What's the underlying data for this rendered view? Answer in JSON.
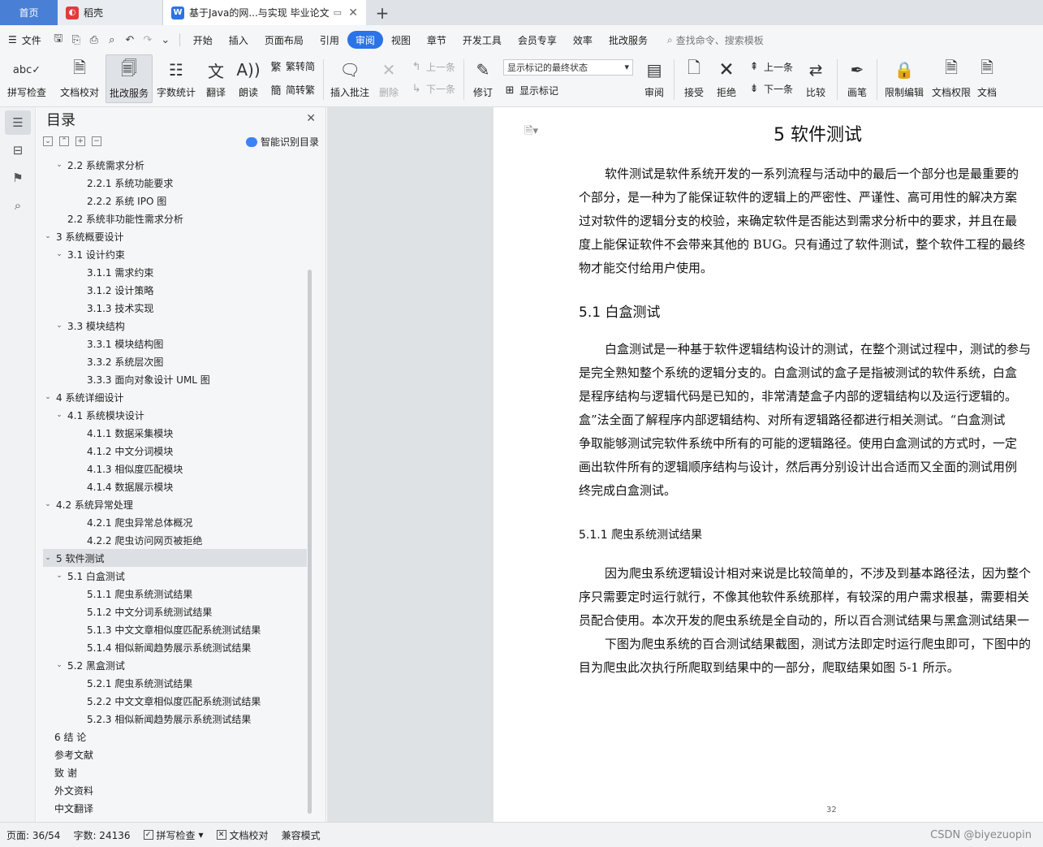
{
  "tabs": {
    "home": "首页",
    "daoke": "稻壳",
    "doc": "基于Java的网...与实现 毕业论文",
    "add": "+"
  },
  "menu": {
    "file": "文件",
    "items": [
      "开始",
      "插入",
      "页面布局",
      "引用",
      "审阅",
      "视图",
      "章节",
      "开发工具",
      "会员专享",
      "效率",
      "批改服务"
    ],
    "active": "审阅",
    "search": "查找命令、搜索模板"
  },
  "ribbon": {
    "spell": "拼写检查",
    "doccheck": "文档校对",
    "correct": "批改服务",
    "wordcount": "字数统计",
    "translate": "翻译",
    "read": "朗读",
    "trad2simp": "繁转简",
    "simp2trad": "简转繁",
    "insert_comment": "插入批注",
    "delete": "删除",
    "prev": "上一条",
    "next": "下一条",
    "revise": "修订",
    "markup_select": "显示标记的最终状态",
    "show_markup": "显示标记",
    "review": "审阅",
    "accept": "接受",
    "reject": "拒绝",
    "prev2": "上一条",
    "next2": "下一条",
    "compare": "比较",
    "pen": "画笔",
    "restrict": "限制编辑",
    "perm": "文档权限",
    "more": "文档"
  },
  "toc": {
    "title": "目录",
    "smart": "智能识别目录",
    "items": [
      {
        "label": "2.2  系统需求分析",
        "level": 2,
        "arrow": true
      },
      {
        "label": "2.2.1  系统功能要求",
        "level": 3,
        "arrow": false
      },
      {
        "label": "2.2.2  系统 IPO 图",
        "level": 3,
        "arrow": false
      },
      {
        "label": "2.2  系统非功能性需求分析",
        "level": 2,
        "arrow": false
      },
      {
        "label": "3    系统概要设计",
        "level": 1,
        "arrow": true
      },
      {
        "label": "3.1  设计约束",
        "level": 2,
        "arrow": true
      },
      {
        "label": "3.1.1  需求约束",
        "level": 3,
        "arrow": false
      },
      {
        "label": "3.1.2  设计策略",
        "level": 3,
        "arrow": false
      },
      {
        "label": "3.1.3  技术实现",
        "level": 3,
        "arrow": false
      },
      {
        "label": "3.3  模块结构",
        "level": 2,
        "arrow": true
      },
      {
        "label": "3.3.1  模块结构图",
        "level": 3,
        "arrow": false
      },
      {
        "label": "3.3.2  系统层次图",
        "level": 3,
        "arrow": false
      },
      {
        "label": "3.3.3  面向对象设计 UML 图",
        "level": 3,
        "arrow": false
      },
      {
        "label": "4  系统详细设计",
        "level": 1,
        "arrow": true
      },
      {
        "label": "4.1  系统模块设计",
        "level": 2,
        "arrow": true
      },
      {
        "label": "4.1.1  数据采集模块",
        "level": 3,
        "arrow": false
      },
      {
        "label": "4.1.2  中文分词模块",
        "level": 3,
        "arrow": false
      },
      {
        "label": "4.1.3  相似度匹配模块",
        "level": 3,
        "arrow": false
      },
      {
        "label": "4.1.4  数据展示模块",
        "level": 3,
        "arrow": false
      },
      {
        "label": "4.2  系统异常处理",
        "level": 1,
        "arrow": true
      },
      {
        "label": "4.2.1  爬虫异常总体概况",
        "level": 3,
        "arrow": false
      },
      {
        "label": "4.2.2  爬虫访问网页被拒绝",
        "level": 3,
        "arrow": false
      },
      {
        "label": "5  软件测试",
        "level": 1,
        "arrow": true,
        "selected": true
      },
      {
        "label": "5.1  白盒测试",
        "level": 2,
        "arrow": true
      },
      {
        "label": "5.1.1  爬虫系统测试结果",
        "level": 3,
        "arrow": false
      },
      {
        "label": "5.1.2  中文分词系统测试结果",
        "level": 3,
        "arrow": false
      },
      {
        "label": "5.1.3  中文文章相似度匹配系统测试结果",
        "level": 3,
        "arrow": false
      },
      {
        "label": "5.1.4  相似新闻趋势展示系统测试结果",
        "level": 3,
        "arrow": false
      },
      {
        "label": "5.2  黑盒测试",
        "level": 2,
        "arrow": true
      },
      {
        "label": "5.2.1  爬虫系统测试结果",
        "level": 3,
        "arrow": false
      },
      {
        "label": "5.2.2  中文文章相似度匹配系统测试结果",
        "level": 3,
        "arrow": false
      },
      {
        "label": "5.2.3  相似新闻趋势展示系统测试结果",
        "level": 3,
        "arrow": false
      },
      {
        "label": "6    结    论",
        "level": 1,
        "arrow": false
      },
      {
        "label": "参考文献",
        "level": 1,
        "arrow": false
      },
      {
        "label": "致    谢",
        "level": 1,
        "arrow": false
      },
      {
        "label": "外文资料",
        "level": 1,
        "arrow": false
      },
      {
        "label": "中文翻译",
        "level": 1,
        "arrow": false
      }
    ]
  },
  "document": {
    "chapter_title": "5  软件测试",
    "p1": [
      "软件测试是软件系统开发的一系列流程与活动中的最后一个部分也是最重要的",
      "个部分，是一种为了能保证软件的逻辑上的严密性、严谨性、高可用性的解决方案",
      "过对软件的逻辑分支的校验，来确定软件是否能达到需求分析中的要求，并且在最",
      "度上能保证软件不会带来其他的 BUG。只有通过了软件测试，整个软件工程的最终",
      "物才能交付给用户使用。"
    ],
    "h2": "5.1  白盒测试",
    "p2": [
      "白盒测试是一种基于软件逻辑结构设计的测试，在整个测试过程中，测试的参与",
      "是完全熟知整个系统的逻辑分支的。白盒测试的盒子是指被测试的软件系统，白盒",
      "是程序结构与逻辑代码是已知的，非常清楚盒子内部的逻辑结构以及运行逻辑的。",
      "盒”法全面了解程序内部逻辑结构、对所有逻辑路径都进行相关测试。“白盒测试",
      "争取能够测试完软件系统中所有的可能的逻辑路径。使用白盒测试的方式时，一定",
      "画出软件所有的逻辑顺序结构与设计，然后再分别设计出合适而又全面的测试用例",
      "终完成白盒测试。"
    ],
    "h3": "5.1.1  爬虫系统测试结果",
    "p3": [
      "因为爬虫系统逻辑设计相对来说是比较简单的，不涉及到基本路径法，因为整个",
      "序只需要定时运行就行，不像其他软件系统那样，有较深的用户需求根基，需要相关",
      "员配合使用。本次开发的爬虫系统是全自动的，所以百合测试结果与黑盒测试结果一",
      "下图为爬虫系统的百合测试结果截图，测试方法即定时运行爬虫即可，下图中的",
      "目为爬虫此次执行所爬取到结果中的一部分，爬取结果如图 5-1 所示。"
    ],
    "page_number": "32"
  },
  "status": {
    "page": "页面: 36/54",
    "words": "字数: 24136",
    "spell": "拼写检查",
    "doccheck": "文档校对",
    "compat": "兼容模式",
    "watermark": "CSDN @biyezuopin"
  }
}
